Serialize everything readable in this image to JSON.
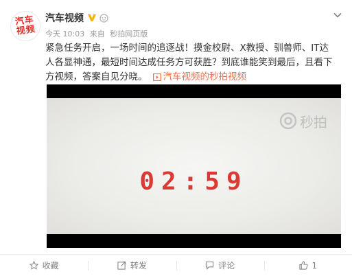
{
  "post": {
    "avatar_text": "汽车视频",
    "user_name": "汽车视频",
    "time": "今天 10:03",
    "source_prefix": "来自",
    "source": "秒拍网页版",
    "text": "紧急任务开启，一场时间的追逐战！摸金校尉、X教授、驯兽师、IT达人各显神通，最短时间达成任务方可获胜？到底谁能笑到最后，且看下方视频，答案自见分晓。",
    "video_link": "汽车视频的秒拍视频",
    "video": {
      "countdown": "02:59",
      "watermark": "秒拍"
    }
  },
  "actions": {
    "favorite": "收藏",
    "repost": "转发",
    "comment": "评论",
    "like": "1"
  },
  "colors": {
    "accent": "#eb7350",
    "countdown": "#d83a34",
    "verified": "#f5b400"
  },
  "icons": [
    "chevron-down-icon",
    "verified-v-icon",
    "star-icon",
    "repost-icon",
    "comment-icon",
    "like-icon",
    "video-play-icon",
    "camera-icon"
  ]
}
